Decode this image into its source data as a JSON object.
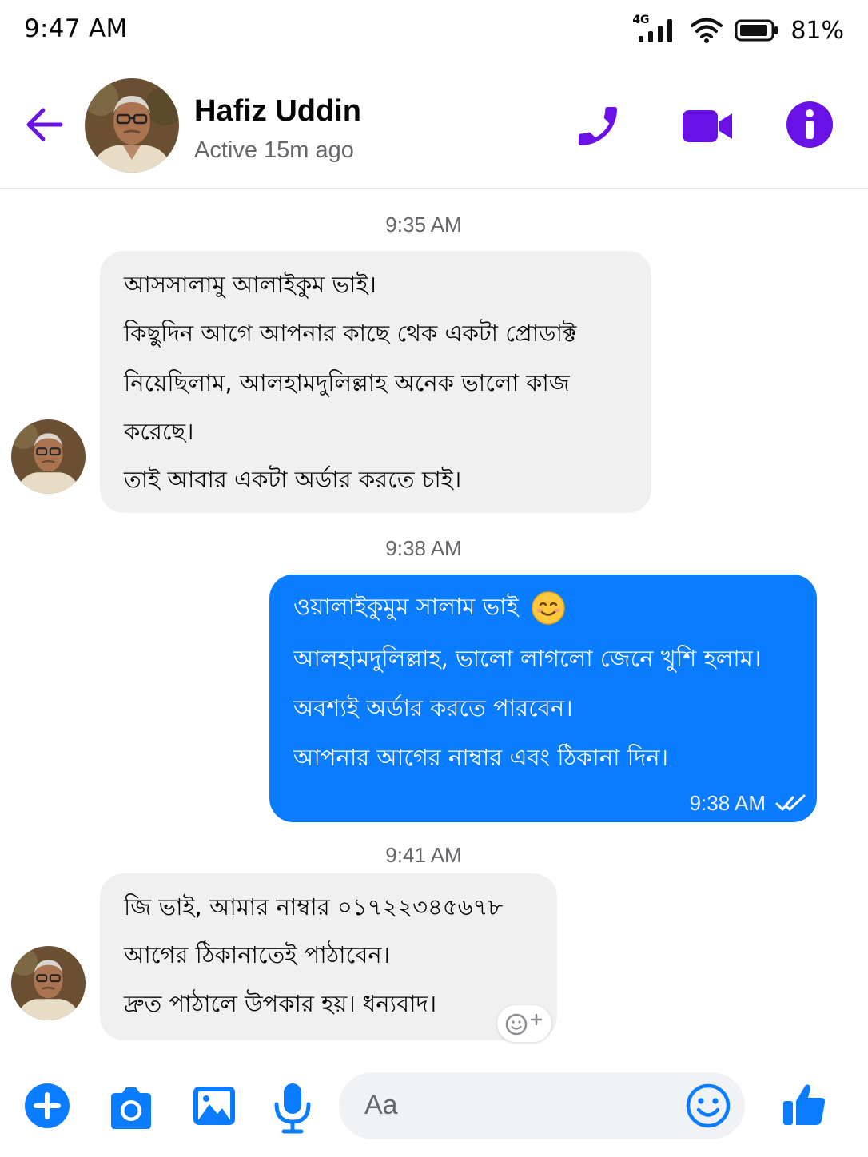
{
  "status_bar": {
    "time": "9:47 AM",
    "network_label": "4G",
    "battery_percent": "81%",
    "icons": [
      "signal-icon",
      "wifi-icon",
      "battery-icon"
    ]
  },
  "header": {
    "contact_name": "Hafiz Uddin",
    "contact_status": "Active 15m ago",
    "icons": [
      "back-arrow-icon",
      "phone-icon",
      "video-icon",
      "info-icon"
    ]
  },
  "conversation": {
    "timestamps": [
      "9:35 AM",
      "9:38 AM",
      "9:41 AM"
    ],
    "messages": [
      {
        "sender": "contact",
        "lines": [
          "আসসালামু আলাইকুম ভাই।",
          "কিছুদিন আগে আপনার কাছে থেক একটা প্রোডাক্ট",
          "নিয়েছিলাম, আলহামদুলিল্লাহ অনেক ভালো কাজ",
          "করেছে।",
          "তাই আবার একটা অর্ডার করতে চাই।"
        ]
      },
      {
        "sender": "me",
        "lines": [
          "ওয়ালাইকুমুম সালাম ভাই",
          "আলহামদুলিল্লাহ, ভালো লাগলো জেনে খুশি হলাম।",
          "অবশ্যই অর্ডার করতে পারবেন।",
          "আপনার আগের নাম্বার এবং ঠিকানা দিন।"
        ],
        "time": "9:38 AM",
        "status": "seen"
      },
      {
        "sender": "contact",
        "lines": [
          "জি ভাই, আমার নাম্বার ০১৭২২৩৪৫৬৭৮",
          "আগের ঠিকানাতেই পাঠাবেন।",
          "দ্রুত পাঠালে উপকার হয়। ধন্যবাদ।"
        ]
      }
    ]
  },
  "composer": {
    "placeholder": "Aa",
    "icons": [
      "plus-icon",
      "camera-icon",
      "gallery-icon",
      "microphone-icon",
      "emoji-icon",
      "thumbs-up-icon"
    ]
  },
  "colors": {
    "accent": "#0a7cff",
    "header_icons": "#6a11e6",
    "incoming_bubble": "#f0f0f0",
    "secondary_text": "#65676b"
  }
}
